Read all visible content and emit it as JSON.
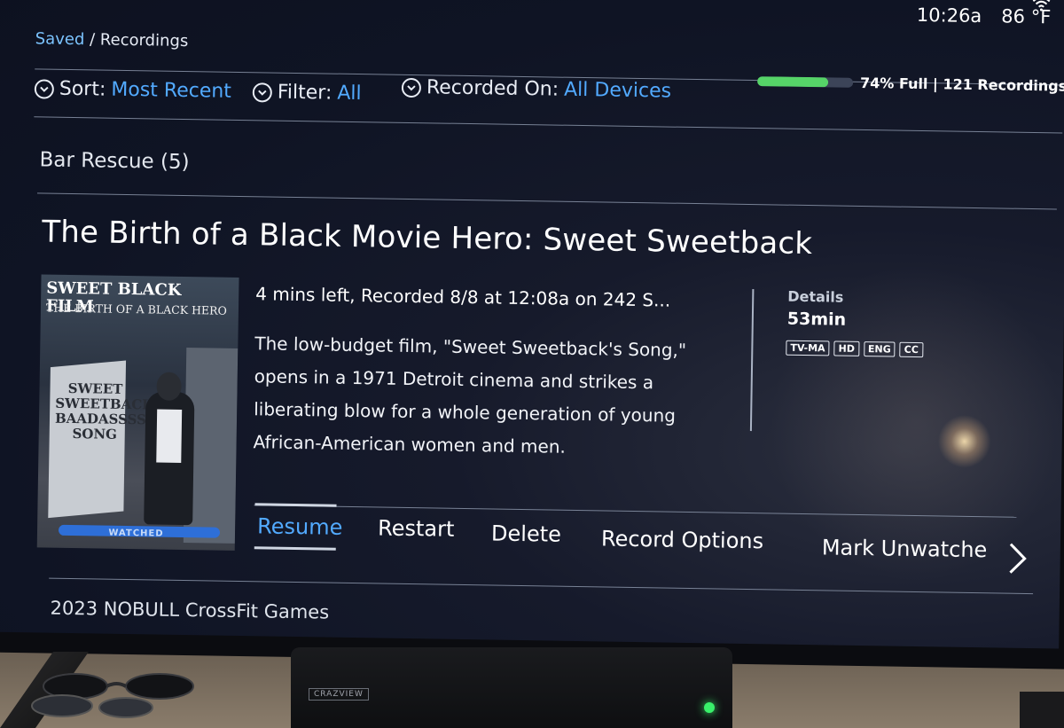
{
  "status": {
    "time": "10:26a",
    "temperature": "86 °F"
  },
  "breadcrumb": {
    "parent": "Saved",
    "separator": "/",
    "current": "Recordings"
  },
  "toolbar": {
    "sort_label": "Sort:",
    "sort_value": "Most Recent",
    "filter_label": "Filter:",
    "filter_value": "All",
    "recorded_label": "Recorded On:",
    "recorded_value": "All Devices",
    "storage_text": "74% Full | 121 Recordings",
    "storage_percent": 74
  },
  "series": {
    "title": "Bar Rescue (5)"
  },
  "episode": {
    "title": "The Birth of a Black Movie Hero: Sweet Sweetback",
    "meta": "4 mins left, Recorded 8/8 at 12:08a on 242 S...",
    "description": "The low-budget film, \"Sweet Sweetback's Song,\" opens in a 1971 Detroit cinema and strikes a liberating blow for a whole generation of young African-American women and men.",
    "details_label": "Details",
    "duration": "53min",
    "badges": [
      "TV-MA",
      "HD",
      "ENG",
      "CC"
    ]
  },
  "poster": {
    "title": "SWEET BLACK FILM",
    "subtitle": "THE BIRTH OF A BLACK HERO",
    "marquee": "SWEET SWEETBACKS BAADASSSSS SONG",
    "watched_label": "WATCHED"
  },
  "actions": {
    "resume": "Resume",
    "restart": "Restart",
    "delete": "Delete",
    "record_options": "Record Options",
    "mark_unwatched": "Mark Unwatche"
  },
  "next_series": {
    "title": "2023 NOBULL CrossFit Games"
  },
  "soundbar": {
    "brand": "CRAZVIEW"
  },
  "icons": [
    "wifi-icon",
    "chevron-down-icon",
    "chevron-right-icon"
  ],
  "colors": {
    "accent": "#52aaff",
    "storage_fill": "#56d468",
    "watched_bar": "#2e6fd8"
  }
}
